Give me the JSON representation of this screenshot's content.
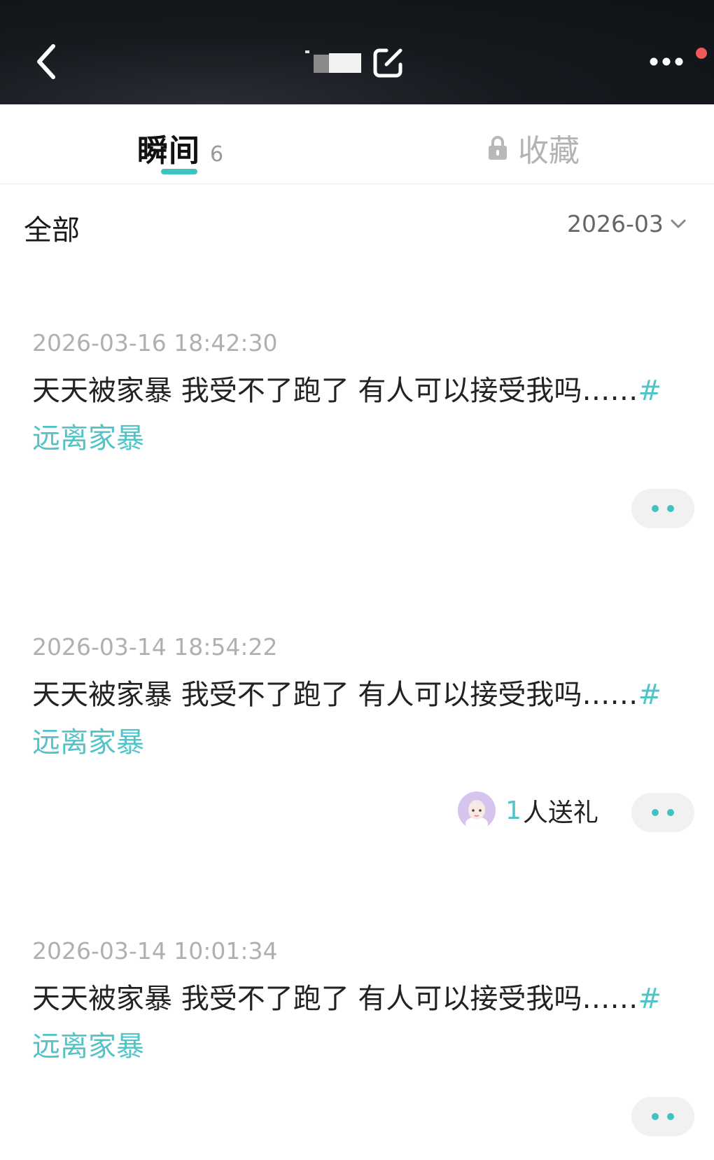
{
  "header": {
    "back_icon": "chevron-left-icon",
    "edit_icon": "edit-icon",
    "more_icon": "more-horizontal-icon",
    "notification_dot_color": "#f2575a"
  },
  "tabs": {
    "moments_label": "瞬间",
    "moments_count": "6",
    "favorites_label": "收藏",
    "favorites_icon": "lock-icon",
    "accent_color": "#3fc3c0"
  },
  "filter": {
    "all_label": "全部",
    "month_value": "2026-03"
  },
  "posts": [
    {
      "time": "2026-03-16 18:42:30",
      "text": "天天被家暴 我受不了跑了 有人可以接受我吗……",
      "tag_hash": "#",
      "tag": "远离家暴"
    },
    {
      "time": "2026-03-14 18:54:22",
      "text": "天天被家暴 我受不了跑了 有人可以接受我吗……",
      "tag_hash": "#",
      "tag": "远离家暴",
      "gift": {
        "count": "1",
        "label": "人送礼"
      }
    },
    {
      "time": "2026-03-14 10:01:34",
      "text": "天天被家暴 我受不了跑了 有人可以接受我吗……",
      "tag_hash": "#",
      "tag": "远离家暴"
    }
  ]
}
